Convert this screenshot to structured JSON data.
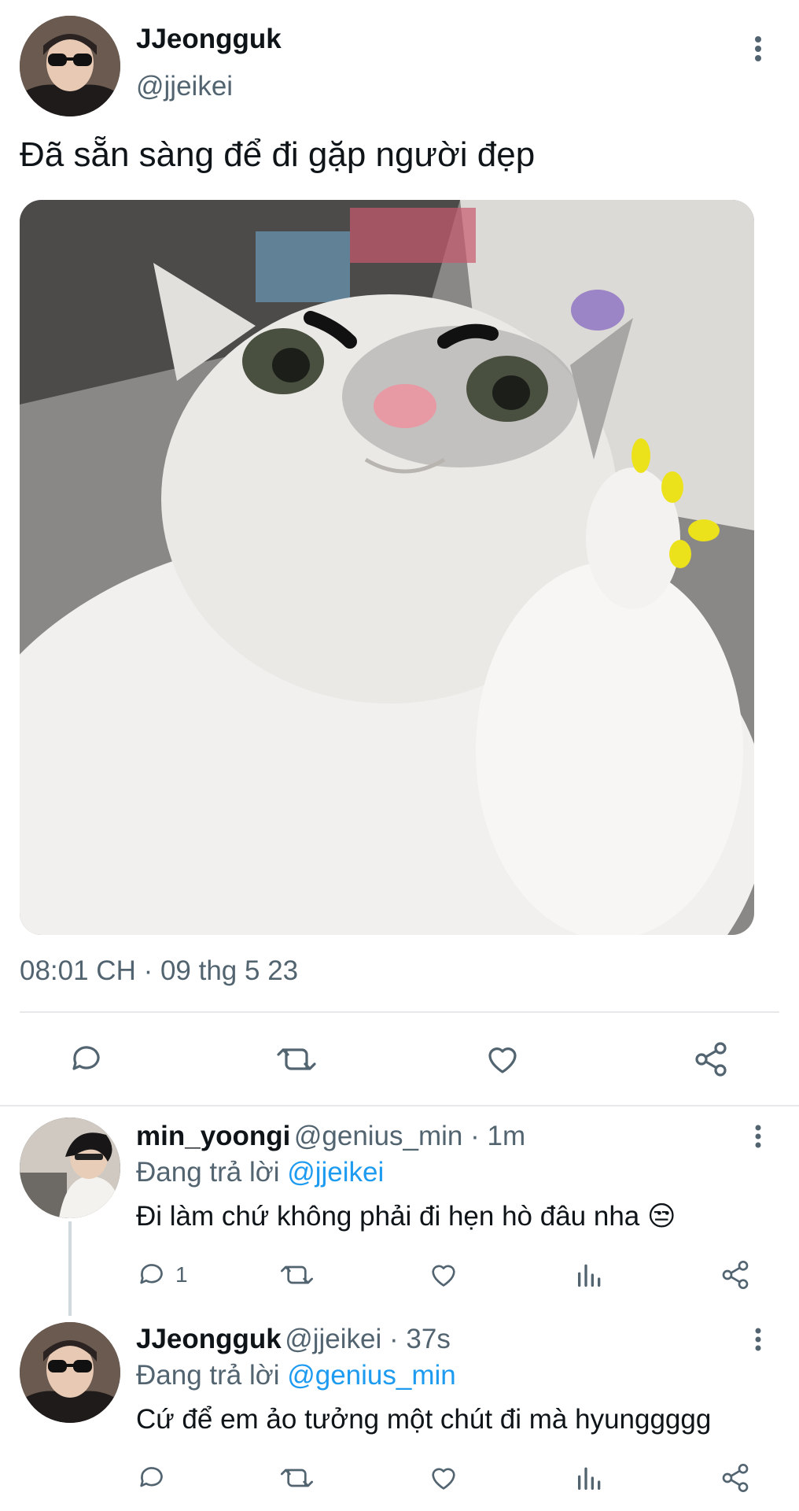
{
  "main_tweet": {
    "author_name": "JJeongguk",
    "author_handle": "@jjeikei",
    "text": "Đã sẵn sàng để đi gặp người đẹp",
    "timestamp": "08:01 CH · 09 thg 5 23",
    "image_desc": "cat-thumbs-up-photo"
  },
  "replies": [
    {
      "author_name": "min_yoongi",
      "meta": "@genius_min · 1m",
      "replying_prefix": "Đang trả lời ",
      "replying_to": "@jjeikei",
      "text": "Đi làm chứ không phải đi hẹn hò đâu nha 😒",
      "reply_count": "1"
    },
    {
      "author_name": "JJeongguk",
      "meta": "@jjeikei · 37s",
      "replying_prefix": "Đang trả lời ",
      "replying_to": "@genius_min",
      "text": "Cứ để em ảo tưởng một chút đi mà hyunggggg",
      "reply_count": ""
    }
  ],
  "colors": {
    "link": "#1d9bf0",
    "muted": "#536471",
    "text": "#0f1419"
  }
}
